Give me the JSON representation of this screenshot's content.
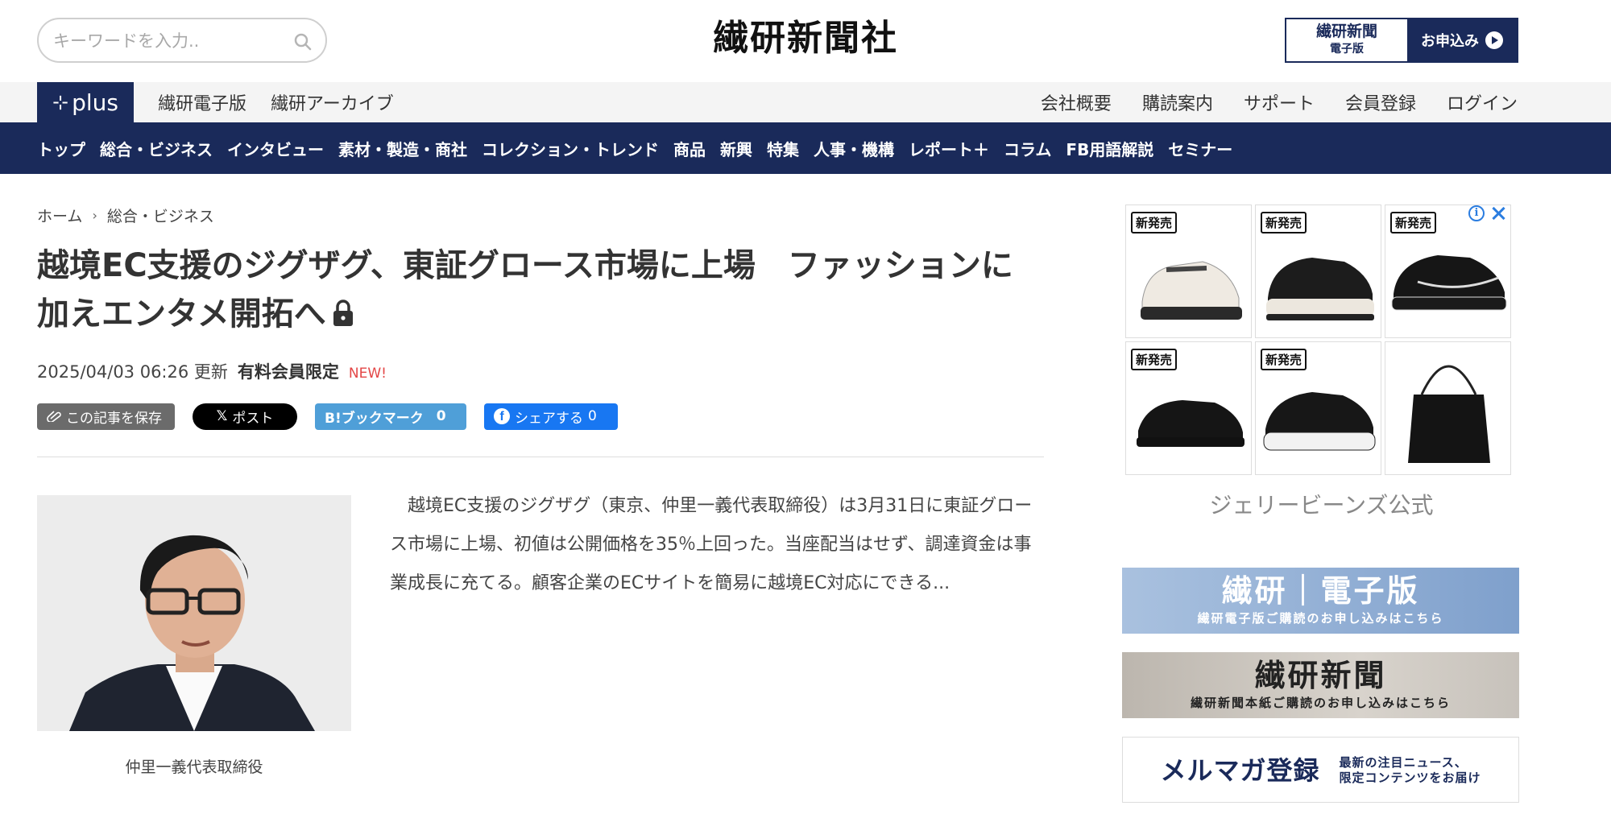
{
  "header": {
    "search_placeholder": "キーワードを入力..",
    "logo": "繊研新聞社",
    "subscribe": {
      "line1": "繊研新聞",
      "line2": "電子版",
      "cta": "お申込み"
    }
  },
  "subnav": {
    "plus_label": "plus",
    "left": [
      "繊研電子版",
      "繊研アーカイブ"
    ],
    "right": [
      "会社概要",
      "購読案内",
      "サポート",
      "会員登録",
      "ログイン"
    ]
  },
  "mainnav": [
    "トップ",
    "総合・ビジネス",
    "インタビュー",
    "素材・製造・商社",
    "コレクション・トレンド",
    "商品",
    "新興",
    "特集",
    "人事・機構",
    "レポート＋",
    "コラム",
    "FB用語解説",
    "セミナー"
  ],
  "breadcrumb": [
    "ホーム",
    "総合・ビジネス"
  ],
  "article": {
    "title": "越境EC支援のジグザグ、東証グロース市場に上場　ファッションに加えエンタメ開拓へ",
    "date": "2025/04/03 06:26 更新",
    "paid": "有料会員限定",
    "new_badge": "NEW!",
    "share": {
      "save": "この記事を保存",
      "x": "ポスト",
      "hatena": "B!ブックマーク",
      "hatena_count": "0",
      "facebook": "シェアする",
      "facebook_count": "0"
    },
    "caption": "仲里一義代表取締役",
    "body": "越境EC支援のジグザグ（東京、仲里一義代表取締役）は3月31日に東証グロース市場に上場、初値は公開価格を35％上回った。当座配当はせず、調達資金は事業成長に充てる。顧客企業のECサイトを簡易に越境EC対応にできる..."
  },
  "ad": {
    "badge": "新発売",
    "brand": "ジェリービーンズ公式"
  },
  "banners": {
    "digital": {
      "title": "繊研｜電子版",
      "sub": "繊研電子版ご購読のお申し込みはこちら"
    },
    "paper": {
      "title": "繊研新聞",
      "sub": "繊研新聞本紙ご購読のお申し込みはこちら"
    },
    "mailmag": {
      "title": "メルマガ登録",
      "sub1": "最新の注目ニュース、",
      "sub2": "限定コンテンツをお届け"
    }
  }
}
